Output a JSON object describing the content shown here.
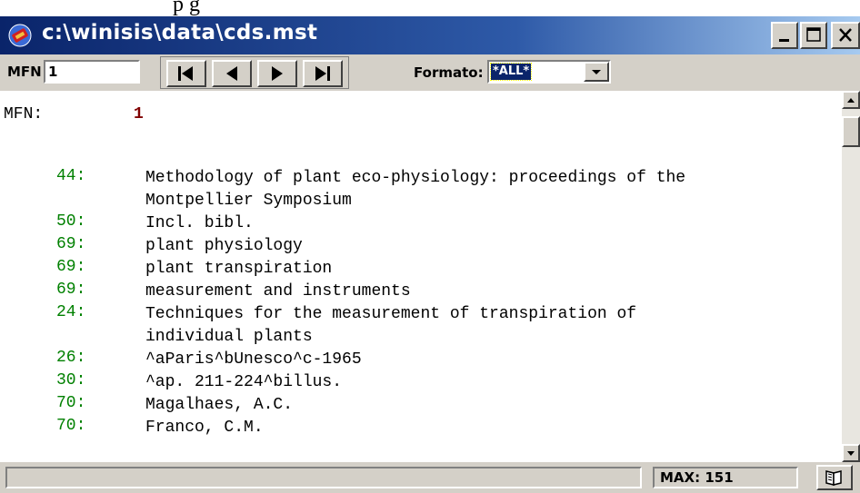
{
  "page_top_text": "p                                                        g",
  "window": {
    "title": "c:\\winisis\\data\\cds.mst",
    "buttons": [
      "minimize",
      "maximize",
      "close"
    ]
  },
  "toolbar": {
    "mfn_label": "MFN",
    "mfn_value": "1",
    "nav_buttons": [
      "first-record",
      "previous-record",
      "next-record",
      "last-record"
    ],
    "formato_label": "Formato:",
    "formato_value": "*ALL*"
  },
  "record": {
    "mfn_label": "MFN:",
    "mfn_value": "1",
    "fields": [
      {
        "tag": "44:",
        "lines": [
          "Methodology of plant eco-physiology: proceedings of the",
          "Montpellier Symposium"
        ]
      },
      {
        "tag": "50:",
        "lines": [
          "Incl. bibl."
        ]
      },
      {
        "tag": "69:",
        "lines": [
          "plant physiology"
        ]
      },
      {
        "tag": "69:",
        "lines": [
          "plant transpiration"
        ]
      },
      {
        "tag": "69:",
        "lines": [
          "measurement and instruments"
        ]
      },
      {
        "tag": "24:",
        "lines": [
          "Techniques for the measurement of transpiration of",
          "individual plants"
        ]
      },
      {
        "tag": "26:",
        "lines": [
          "^aParis^bUnesco^c-1965"
        ]
      },
      {
        "tag": "30:",
        "lines": [
          "^ap. 211-224^billus."
        ]
      },
      {
        "tag": "70:",
        "lines": [
          "Magalhaes, A.C."
        ]
      },
      {
        "tag": "70:",
        "lines": [
          "Franco, C.M."
        ]
      }
    ]
  },
  "statusbar": {
    "message": "",
    "max_text": "MAX: 151"
  },
  "colors": {
    "titlebar_start": "#0a246a",
    "titlebar_end": "#a6caf0",
    "tag_color": "#008000",
    "mfn_value_color": "#800000",
    "chrome": "#d4d0c8"
  }
}
